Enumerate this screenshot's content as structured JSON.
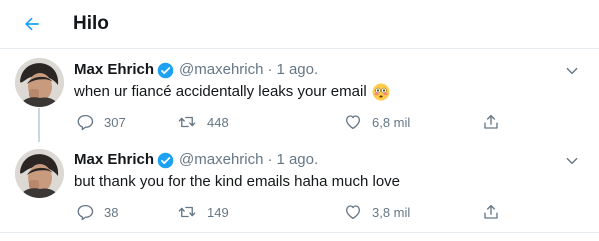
{
  "header": {
    "title": "Hilo",
    "back_icon": "arrow-left-icon"
  },
  "colors": {
    "accent": "#1da1f2",
    "text": "#14171a",
    "secondary": "#657786",
    "divider": "#e6ecf0"
  },
  "tweets": [
    {
      "author_name": "Max Ehrich",
      "verified": true,
      "handle": "@maxehrich",
      "separator": "·",
      "time": "1 ago.",
      "text": "when ur fiancé accidentally leaks your email",
      "emoji": "flushed-face",
      "replies": "307",
      "retweets": "448",
      "likes": "6,8 mil"
    },
    {
      "author_name": "Max Ehrich",
      "verified": true,
      "handle": "@maxehrich",
      "separator": "·",
      "time": "1 ago.",
      "text": "but thank you for the kind emails haha much love",
      "replies": "38",
      "retweets": "149",
      "likes": "3,8 mil"
    }
  ]
}
